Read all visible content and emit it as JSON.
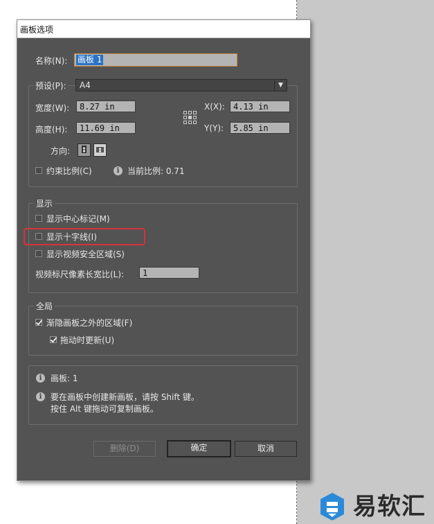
{
  "dialog": {
    "title": "画板选项",
    "name_label": "名称(N):",
    "name_value": "画板 1",
    "preset_label": "预设(P):",
    "preset_value": "A4",
    "width_label": "宽度(W):",
    "width_value": "8.27 in",
    "height_label": "高度(H):",
    "height_value": "11.69 in",
    "x_label": "X(X):",
    "x_value": "4.13 in",
    "y_label": "Y(Y):",
    "y_value": "5.85 in",
    "orientation_label": "方向:",
    "constrain_label": "约束比例(C)",
    "constrain_checked": false,
    "current_ratio_label": "当前比例: 0.71",
    "display": {
      "legend": "显示",
      "show_center_mark": "显示中心标记(M)",
      "show_center_mark_checked": false,
      "show_cross_hairs": "显示十字线(I)",
      "show_cross_hairs_checked": false,
      "show_video_safe": "显示视频安全区域(S)",
      "show_video_safe_checked": false,
      "pixel_ratio_label": "视频标尺像素长宽比(L):",
      "pixel_ratio_value": "1"
    },
    "global": {
      "legend": "全局",
      "fade_outside": "渐隐画板之外的区域(F)",
      "fade_outside_checked": true,
      "update_while_drag": "拖动时更新(U)",
      "update_while_drag_checked": true
    },
    "info": {
      "artboards": "画板: 1",
      "hint_line1": "要在画板中创建新画板，请按 Shift 键。",
      "hint_line2": "按住 Alt 键拖动可复制画板。"
    },
    "buttons": {
      "delete": "删除(D)",
      "ok": "确定",
      "cancel": "取消"
    }
  },
  "watermark": {
    "text": "易软汇",
    "color": "#2b8ad8"
  },
  "highlight_color": "#d9323a"
}
